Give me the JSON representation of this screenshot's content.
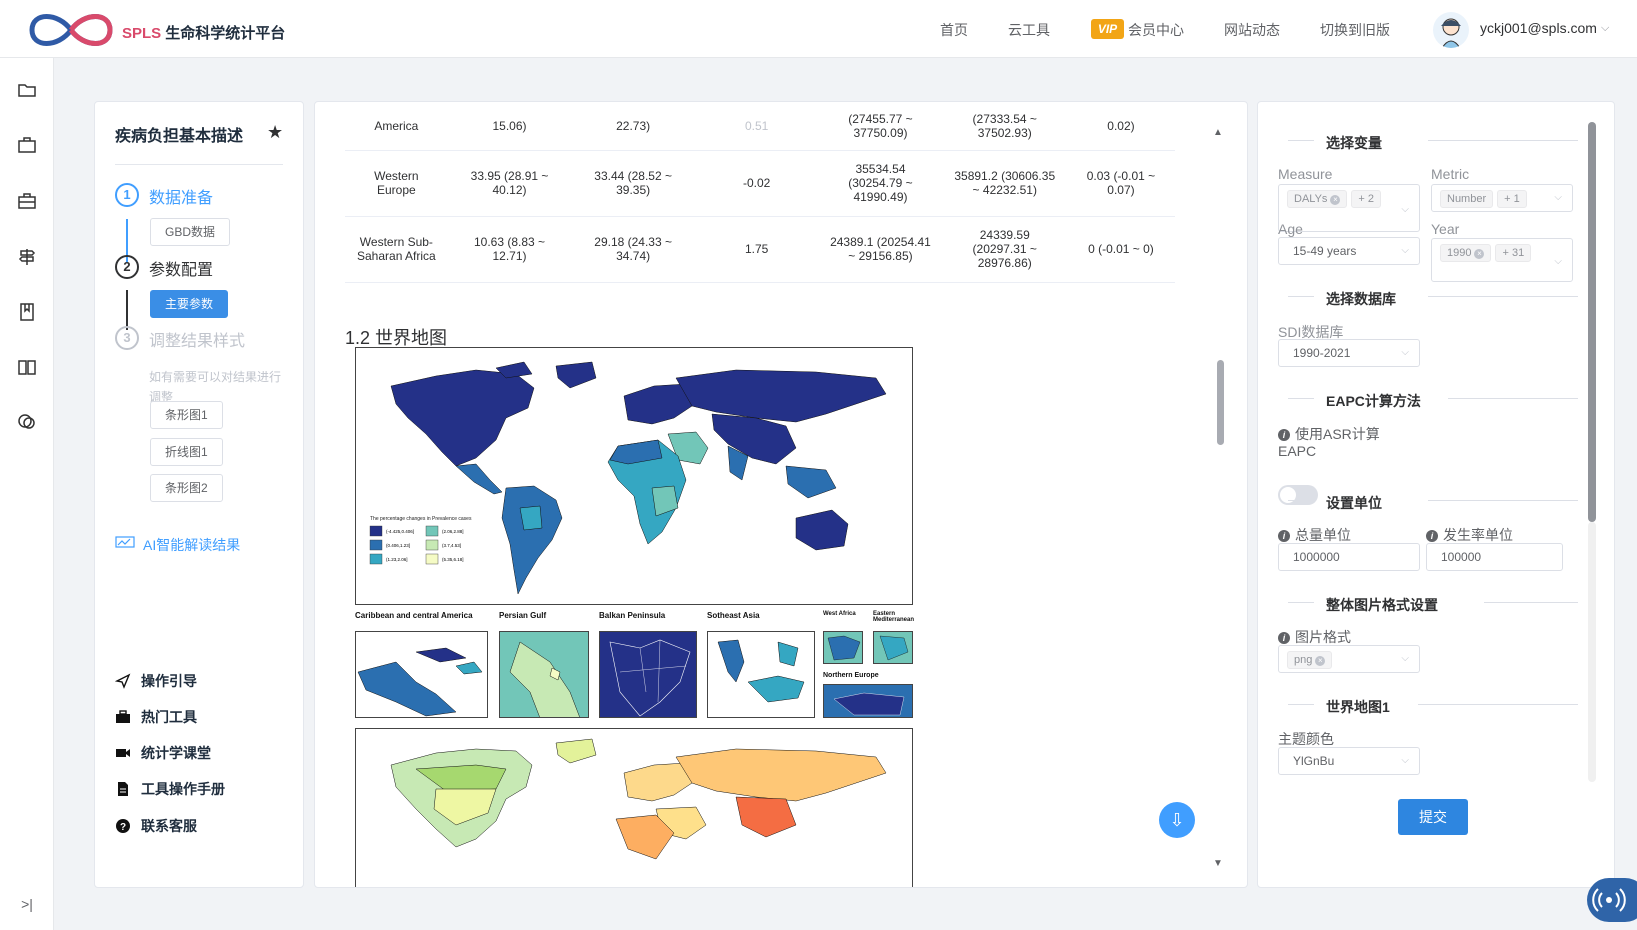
{
  "brand": {
    "abbr": "SPLS",
    "name": "生命科学统计平台"
  },
  "nav": {
    "home": "首页",
    "cloud_tools": "云工具",
    "vip_badge": "VIP",
    "member": "会员中心",
    "news": "网站动态",
    "old_version": "切换到旧版",
    "user": "yckj001@spls.com"
  },
  "rail": {
    "collapse": ">|"
  },
  "steps": {
    "title": "疾病负担基本描述",
    "step1": {
      "num": "1",
      "label": "数据准备",
      "chip": "GBD数据"
    },
    "step2": {
      "num": "2",
      "label": "参数配置",
      "chip": "主要参数"
    },
    "step3": {
      "num": "3",
      "label": "调整结果样式",
      "hint": "如有需要可以对结果进行调整",
      "chips": [
        "条形图1",
        "折线图1",
        "条形图2"
      ]
    },
    "ai": "AI智能解读结果",
    "help": [
      "操作引导",
      "热门工具",
      "统计学课堂",
      "工具操作手册",
      "联系客服"
    ]
  },
  "results": {
    "rows": [
      [
        "America",
        "15.06)",
        "22.73)",
        "0.51",
        "(27455.77 ~ 37750.09)",
        "(27333.54 ~ 37502.93)",
        "0.02)"
      ],
      [
        "Western Europe",
        "33.95 (28.91 ~ 40.12)",
        "33.44 (28.52 ~ 39.35)",
        "-0.02",
        "35534.54 (30254.79 ~ 41990.49)",
        "35891.2 (30606.35 ~ 42232.51)",
        "0.03 (-0.01 ~ 0.07)"
      ],
      [
        "Western Sub-Saharan Africa",
        "10.63 (8.83 ~ 12.71)",
        "29.18 (24.33 ~ 34.74)",
        "1.75",
        "24389.1 (20254.41 ~ 29156.85)",
        "24339.59 (20297.31 ~ 28976.86)",
        "0 (-0.01 ~ 0)"
      ]
    ],
    "section_title": "1.2 世界地图",
    "map_legend": {
      "title": "The percentage changes in Prevalence cases",
      "bins": [
        "(-4.425,0.406]",
        "(0.406,1.23]",
        "(1.23,2.06]",
        "(2.06,2.88]",
        "(3.7,4.53]",
        "(5.35,6.18]"
      ],
      "colors": [
        "#243188",
        "#2b6fb0",
        "#35a7c2",
        "#72c6b8",
        "#c7e9b4",
        "#f5fbc5"
      ]
    },
    "insets": [
      "Caribbean and central America",
      "Persian Gulf",
      "Balkan Peninsula",
      "Sotheast Asia",
      "West Africa",
      "Eastern Mediterranean",
      "Northern Europe"
    ]
  },
  "params": {
    "g_vars": "选择变量",
    "measure": {
      "label": "Measure",
      "tags": [
        "DALYs",
        "+ 2"
      ]
    },
    "metric": {
      "label": "Metric",
      "tags": [
        "Number",
        "+ 1"
      ]
    },
    "age": {
      "label": "Age",
      "value": "15-49 years"
    },
    "year": {
      "label": "Year",
      "tags": [
        "1990",
        "+ 31"
      ]
    },
    "g_db": "选择数据库",
    "sdi": {
      "label": "SDI数据库",
      "value": "1990-2021"
    },
    "g_eapc": "EAPC计算方法",
    "eapc_asr": "使用ASR计算",
    "eapc_label": "EAPC",
    "g_unit": "设置单位",
    "total_unit": {
      "label": "总量单位",
      "value": "1000000"
    },
    "rate_unit": {
      "label": "发生率单位",
      "value": "100000"
    },
    "g_img": "整体图片格式设置",
    "img_fmt": {
      "label": "图片格式",
      "tags": [
        "png"
      ]
    },
    "g_map": "世界地图1",
    "theme": {
      "label": "主题颜色",
      "value": "YlGnBu"
    },
    "submit": "提交"
  }
}
